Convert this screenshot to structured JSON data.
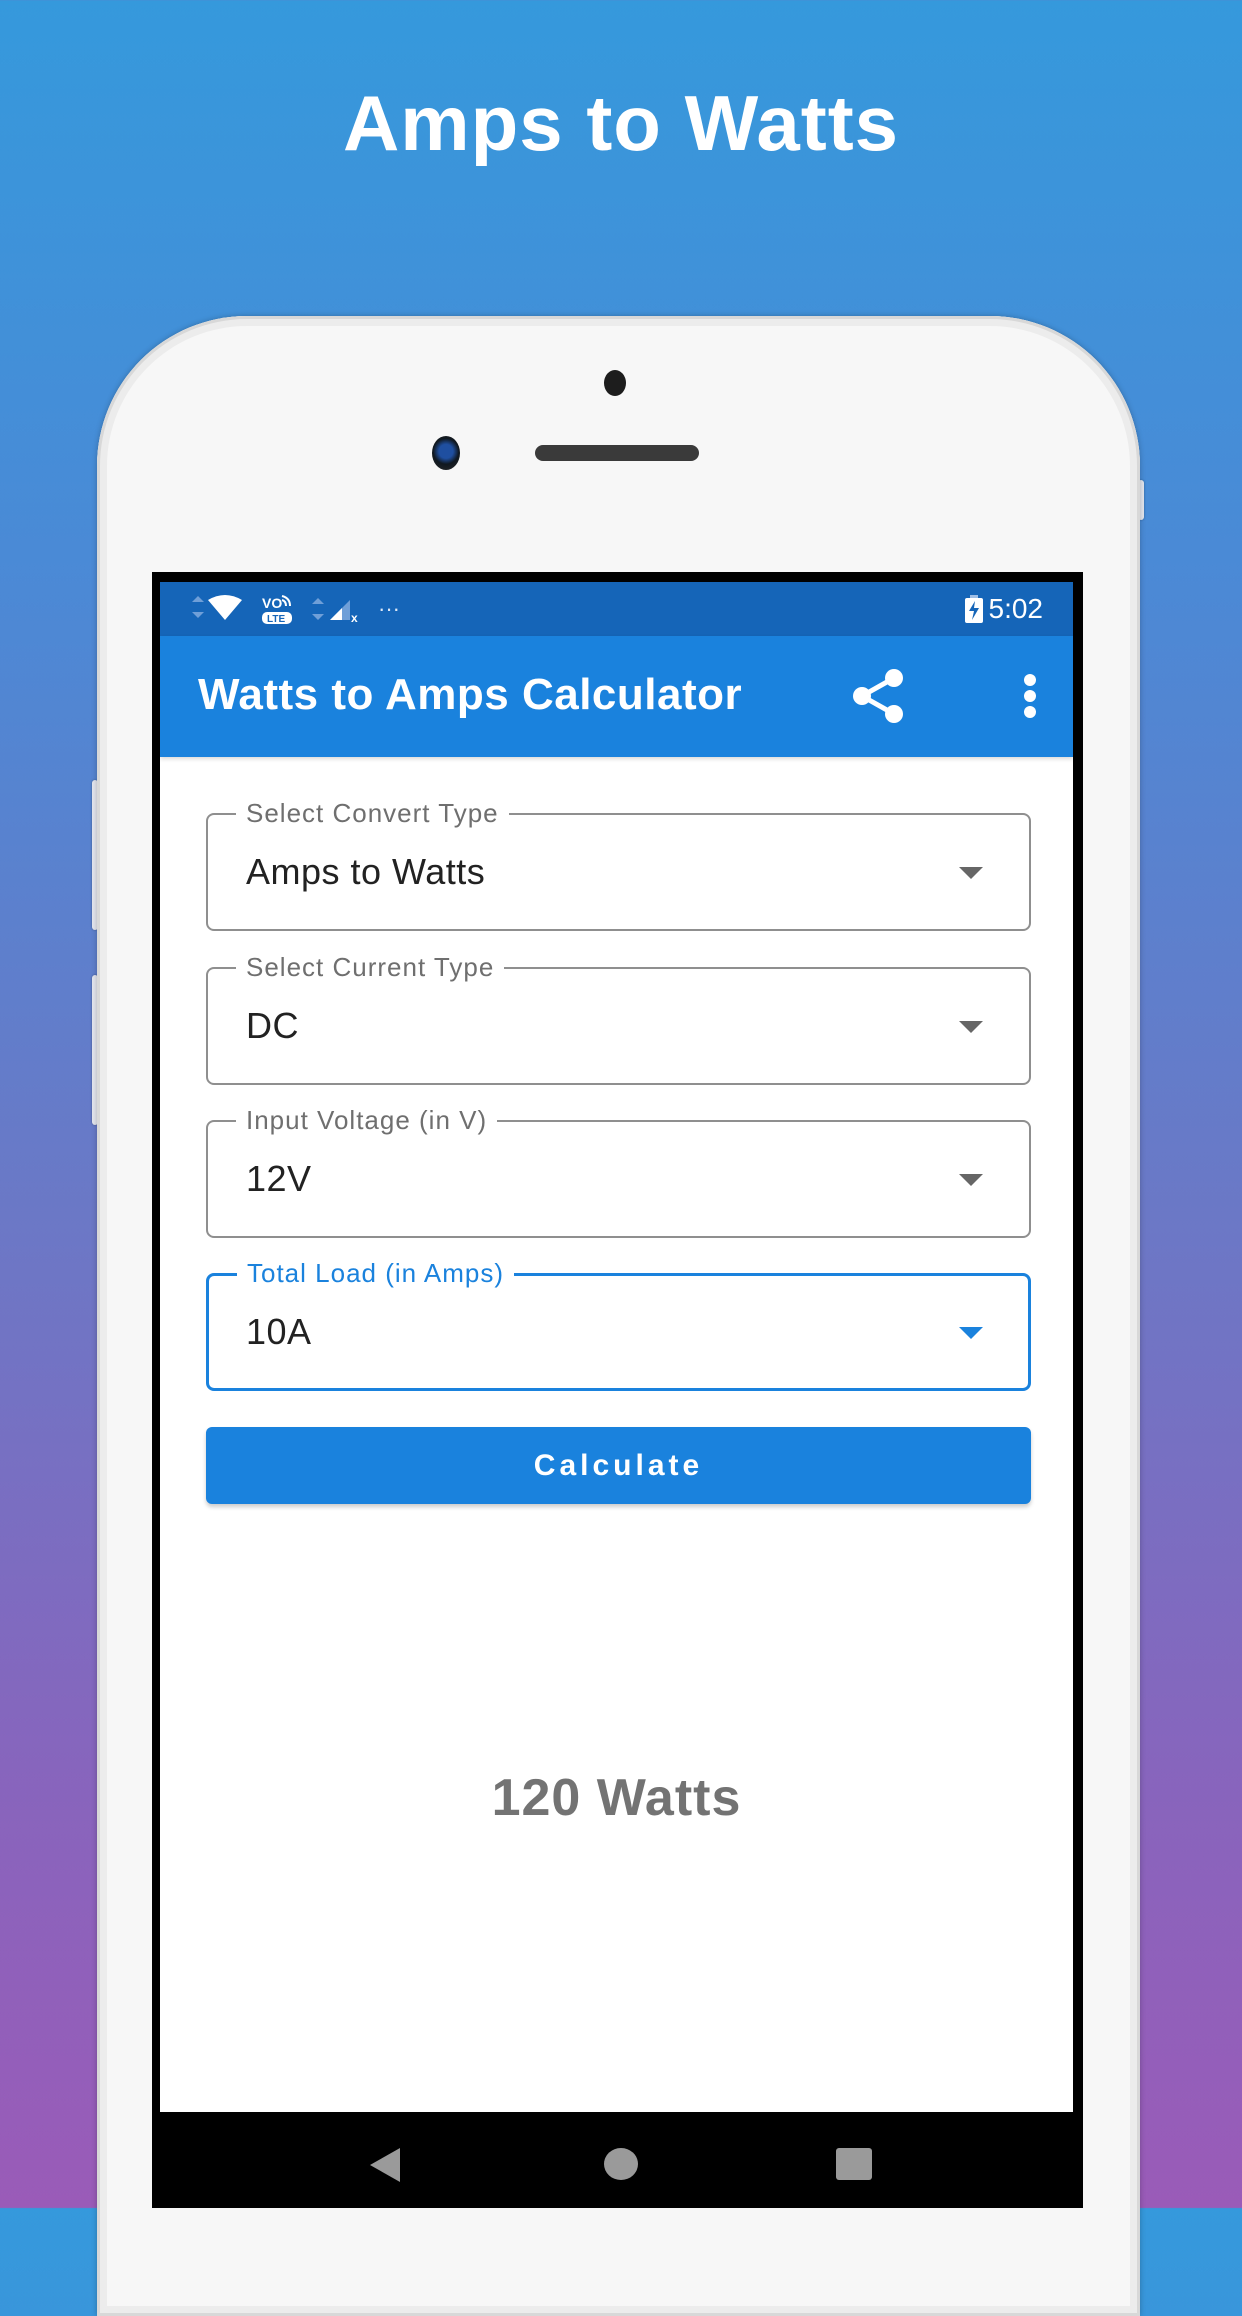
{
  "promo": {
    "title": "Amps to Watts"
  },
  "status_bar": {
    "time": "5:02",
    "overflow_dots": "···",
    "icons": [
      "wifi-icon",
      "volte-icon",
      "signal-icon",
      "battery-charging-icon"
    ]
  },
  "app_bar": {
    "title": "Watts to Amps Calculator",
    "share_icon": "share-icon",
    "more_icon": "more-vert-icon"
  },
  "form": {
    "fields": [
      {
        "label": "Select Convert Type",
        "value": "Amps to Watts",
        "focused": false
      },
      {
        "label": "Select Current Type",
        "value": "DC",
        "focused": false
      },
      {
        "label": "Input Voltage (in V)",
        "value": "12V",
        "focused": false
      },
      {
        "label": "Total Load (in Amps)",
        "value": "10A",
        "focused": true
      }
    ],
    "calculate_label": "Calculate"
  },
  "result": {
    "text": "120 Watts"
  },
  "colors": {
    "primary": "#1a82dd",
    "status_bar": "#1565b8",
    "result_text": "#737373"
  },
  "nav_bar": {
    "icons": [
      "back-icon",
      "home-icon",
      "recents-icon"
    ]
  }
}
